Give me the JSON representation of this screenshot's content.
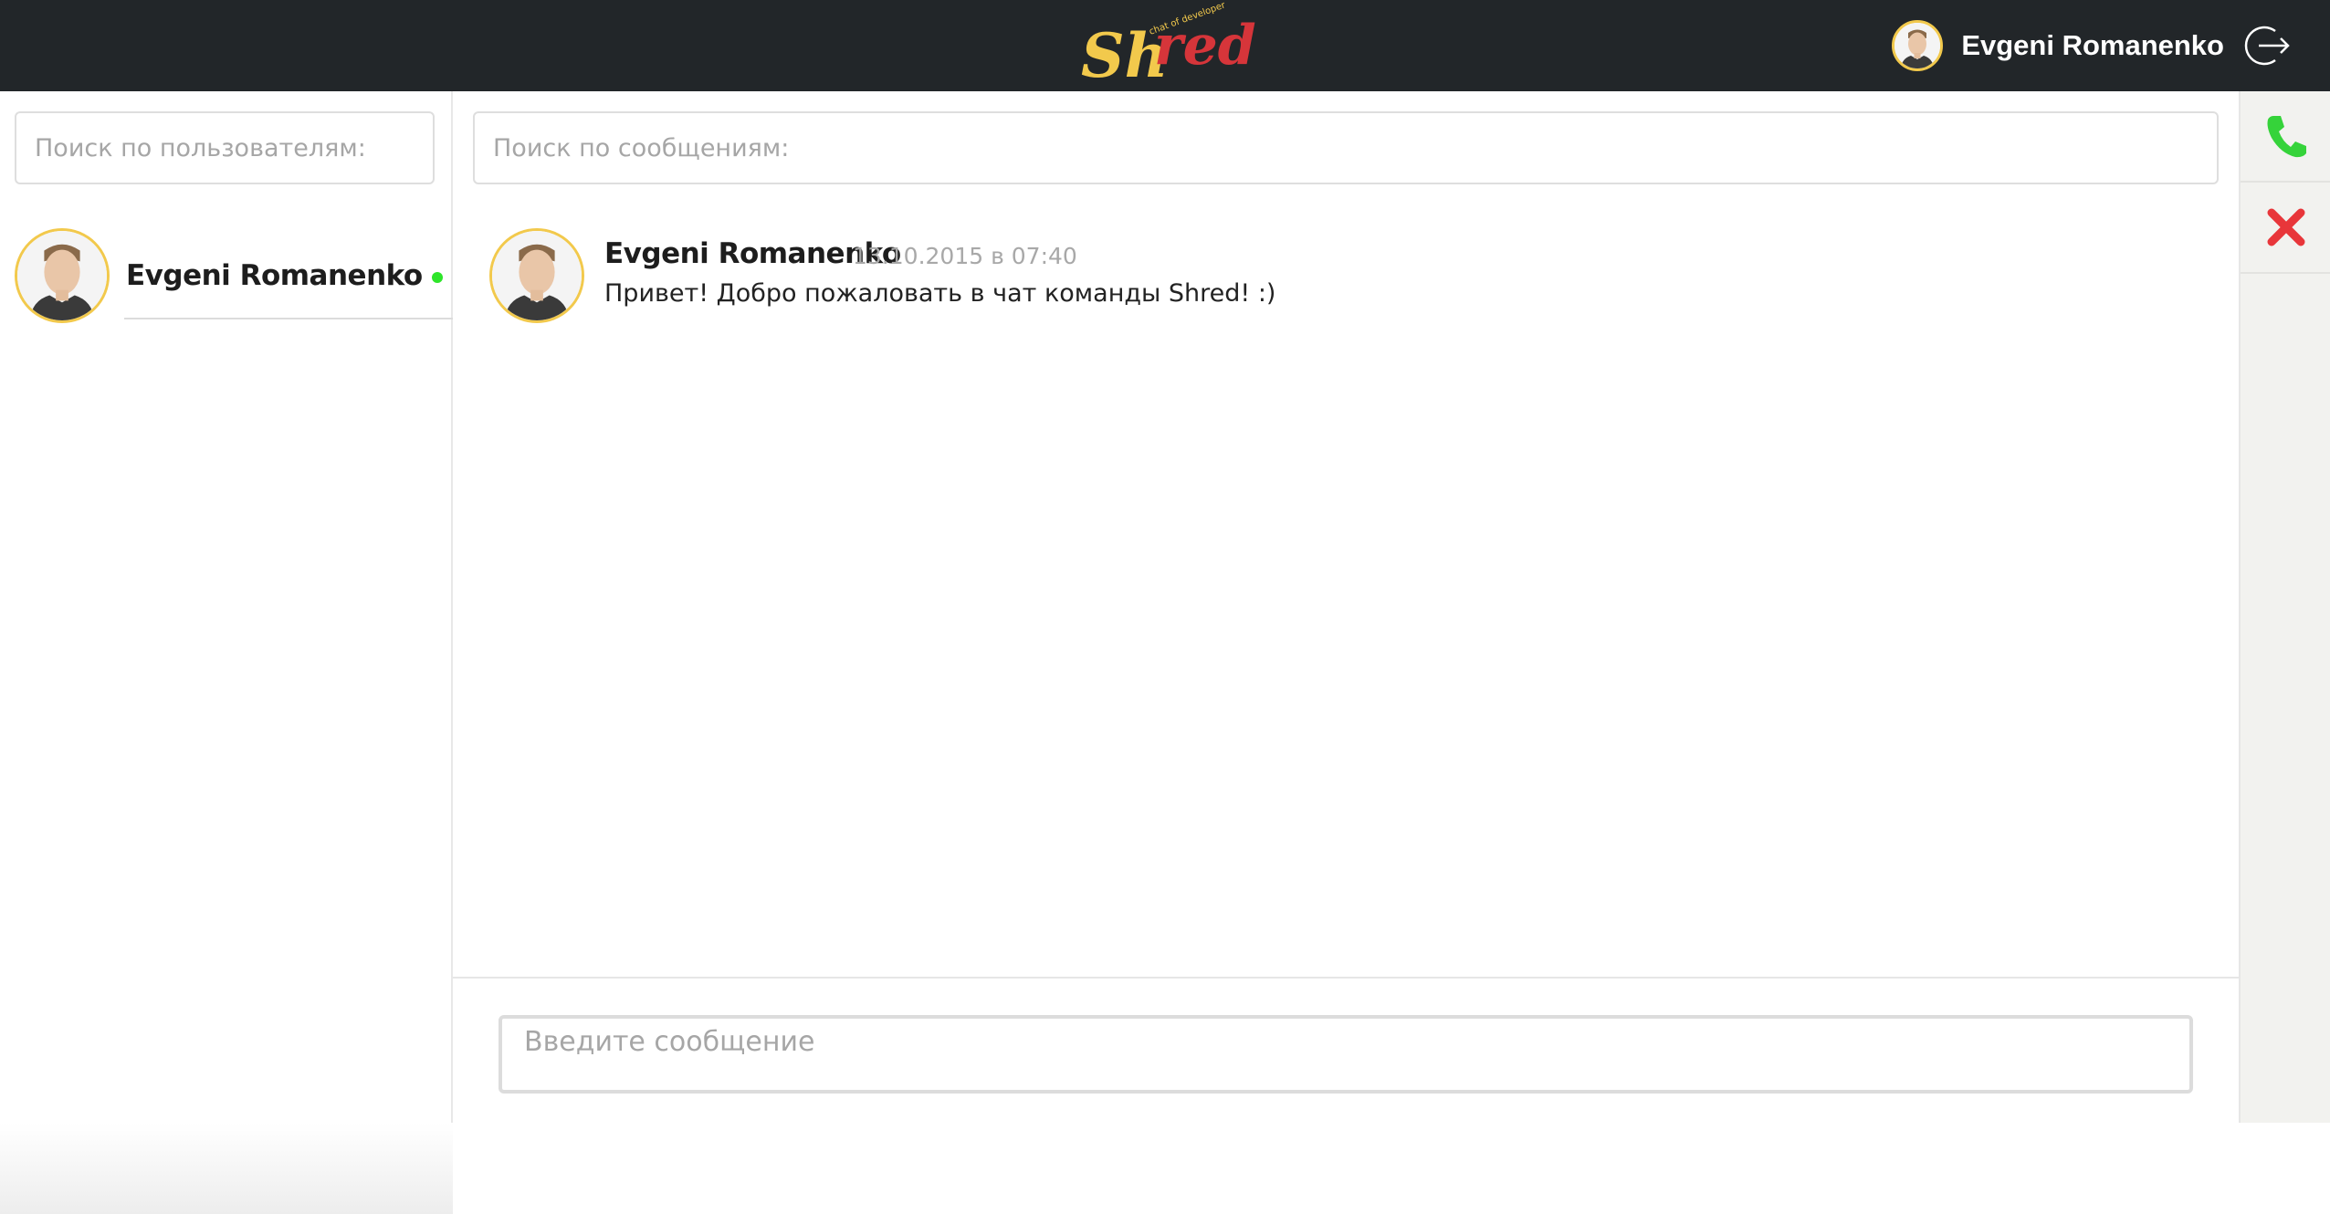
{
  "header": {
    "logo": {
      "main_text": "Shred",
      "tagline": "chat of developer"
    },
    "user_name": "Evgeni Romanenko",
    "logout_icon": "logout-arrow-icon"
  },
  "sidebar": {
    "search_placeholder": "Поиск по пользователям:",
    "users": [
      {
        "name": "Evgeni Romanenko",
        "status": "online"
      }
    ]
  },
  "main": {
    "search_placeholder": "Поиск по сообщениям:",
    "messages": [
      {
        "author": "Evgeni Romanenko",
        "time": "13.10.2015 в 07:40",
        "text": "Привет! Добро пожаловать в чат команды Shred! :)"
      }
    ],
    "composer_placeholder": "Введите сообщение"
  },
  "call_panel": {
    "buttons": [
      {
        "icon": "phone-icon",
        "color": "#35d33a"
      },
      {
        "icon": "close-icon",
        "color": "#e8363a"
      }
    ]
  },
  "colors": {
    "header_bg": "#222629",
    "logo_yellow": "#f2c94c",
    "logo_red": "#d6353a",
    "online": "#2ee52a",
    "avatar_ring": "#f2c94c"
  }
}
